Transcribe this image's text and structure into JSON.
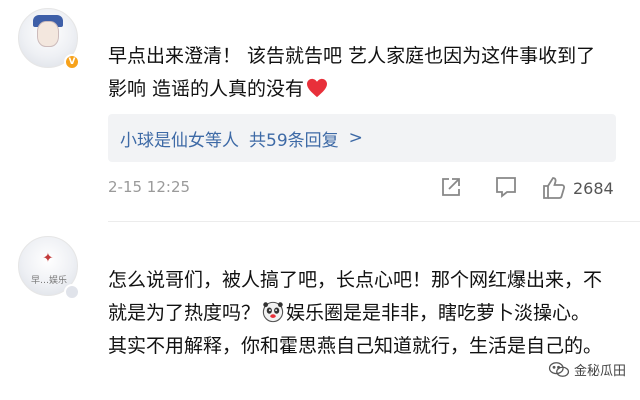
{
  "comments": [
    {
      "avatar_caption": "",
      "text": "早点出来澄清！ 该告就告吧 艺人家庭也因为这件事收到了影响 造谣的人真的没有",
      "emoji": "red-heart",
      "replies_summary": {
        "users": "小球是仙女等人",
        "count_text": "共59条回复",
        "arrow": ">"
      },
      "date": "2-15 12:25",
      "like_count": "2684"
    },
    {
      "avatar_caption": "早…娱乐",
      "text_part1": "怎么说哥们，被人搞了吧，长点心吧！那个网红爆出来，不就是为了热度吗？",
      "emoji": "panda-face",
      "text_part2": "娱乐圈是是非非，瞎吃萝卜淡操心。其实不用解释，你和霍思燕自己知道就行，生活是自己的。"
    }
  ],
  "watermark": {
    "label": "金秘瓜田"
  },
  "colors": {
    "link": "#3e6aa6",
    "meta": "#9a9a9a",
    "verified_badge": "#f7a21b",
    "reply_bg": "#f2f3f5"
  }
}
